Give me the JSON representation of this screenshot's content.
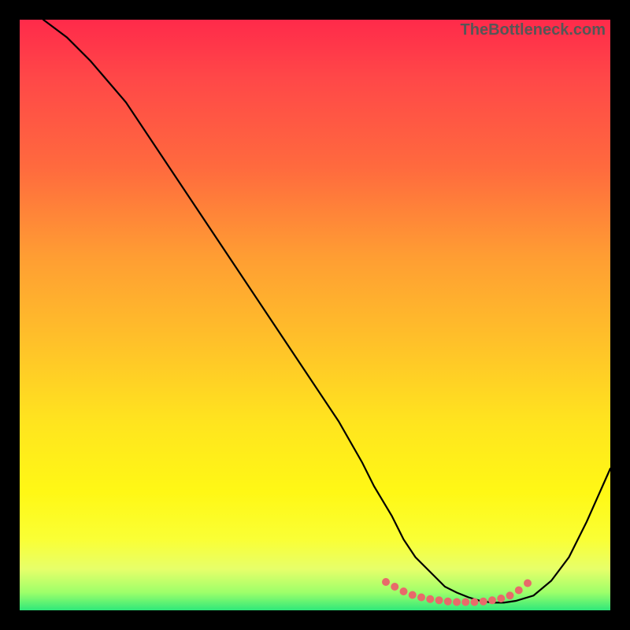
{
  "watermark": "TheBottleneck.com",
  "chart_data": {
    "type": "line",
    "title": "",
    "xlabel": "",
    "ylabel": "",
    "xlim": [
      0,
      100
    ],
    "ylim": [
      0,
      100
    ],
    "series": [
      {
        "name": "curve",
        "color": "#000000",
        "x": [
          4,
          8,
          12,
          18,
          24,
          30,
          36,
          42,
          48,
          54,
          58,
          60,
          63,
          65,
          67,
          70,
          72,
          74,
          76,
          78,
          80,
          82,
          84,
          87,
          90,
          93,
          96,
          100
        ],
        "y": [
          100,
          97,
          93,
          86,
          77,
          68,
          59,
          50,
          41,
          32,
          25,
          21,
          16,
          12,
          9,
          6,
          4,
          3,
          2.2,
          1.6,
          1.3,
          1.3,
          1.6,
          2.5,
          5,
          9,
          15,
          24
        ]
      }
    ],
    "markers": {
      "name": "highlight-dots",
      "color": "#e86a6a",
      "x": [
        62,
        63.5,
        65,
        66.5,
        68,
        69.5,
        71,
        72.5,
        74,
        75.5,
        77,
        78.5,
        80,
        81.5,
        83,
        84.5,
        86
      ],
      "y": [
        4.8,
        4.0,
        3.2,
        2.6,
        2.2,
        1.9,
        1.7,
        1.5,
        1.4,
        1.4,
        1.4,
        1.5,
        1.7,
        2.0,
        2.5,
        3.4,
        4.6
      ]
    },
    "background_gradient": {
      "direction": "top-to-bottom",
      "stops": [
        {
          "pos": 0,
          "color": "#ff2a4a"
        },
        {
          "pos": 25,
          "color": "#ff6a3e"
        },
        {
          "pos": 55,
          "color": "#ffc229"
        },
        {
          "pos": 80,
          "color": "#fff815"
        },
        {
          "pos": 100,
          "color": "#2fe87a"
        }
      ]
    }
  }
}
